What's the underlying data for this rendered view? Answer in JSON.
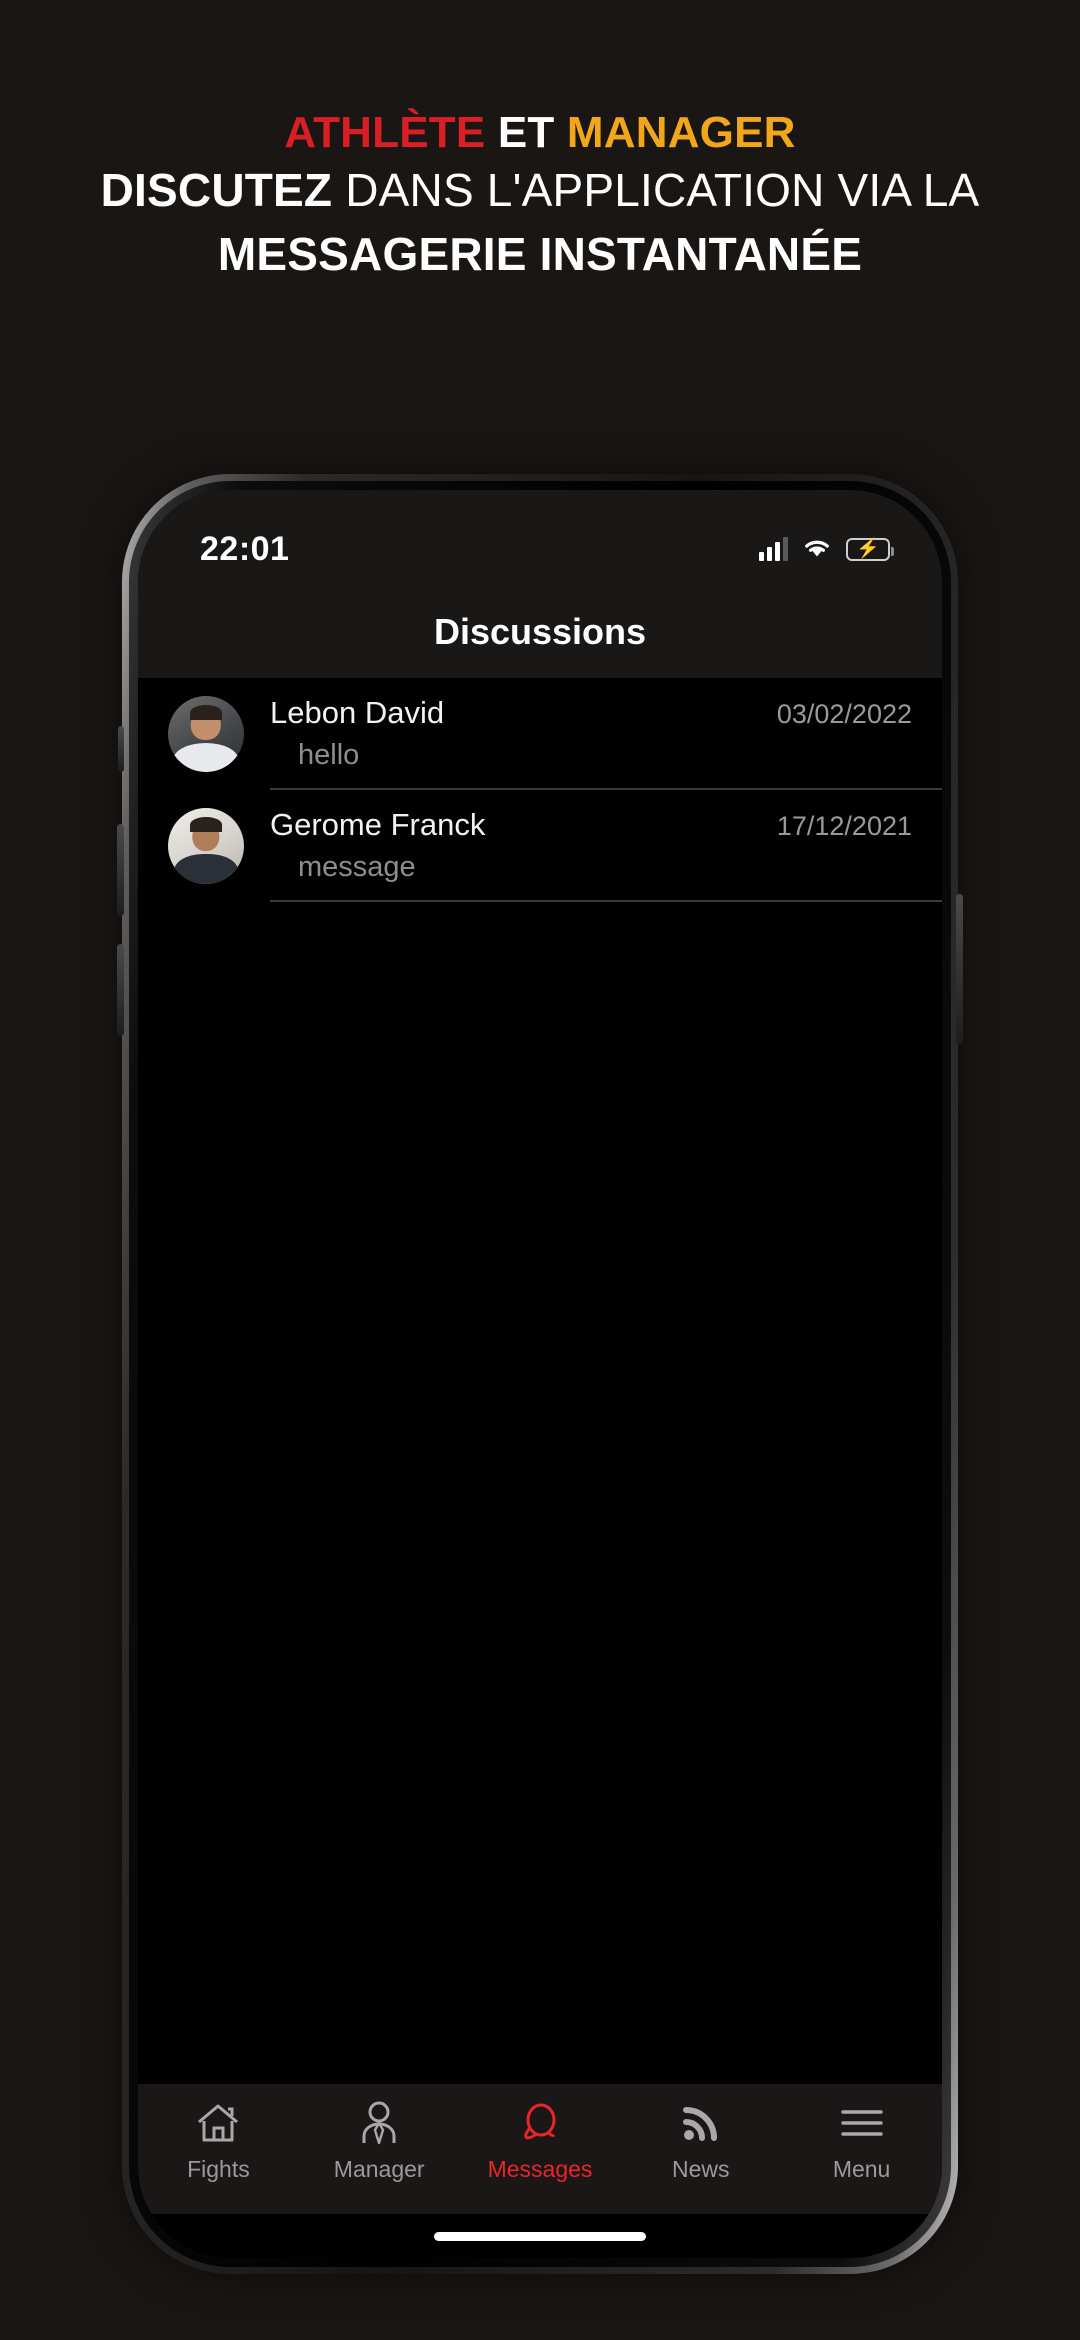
{
  "promo": {
    "line1": {
      "part1": "ATHLÈTE",
      "part2": "ET",
      "part3": "MANAGER"
    },
    "line2": {
      "bold": "DISCUTEZ",
      "rest": "DANS L'APPLICATION VIA LA"
    },
    "line3": "MESSAGERIE INSTANTANÉE",
    "colors": {
      "red": "#d91f26",
      "amber": "#f2a71b",
      "white": "#ffffff",
      "background": "#1a1614"
    }
  },
  "status_bar": {
    "time": "22:01",
    "cellular": "signal-bars-icon",
    "wifi": "wifi-icon",
    "battery": "battery-charging-icon",
    "battery_color": "#2ed158"
  },
  "nav": {
    "title": "Discussions"
  },
  "conversations": [
    {
      "name": "Lebon David",
      "preview": "hello",
      "date": "03/02/2022",
      "avatar": "photo-bearded-man"
    },
    {
      "name": "Gerome Franck",
      "preview": "message",
      "date": "17/12/2021",
      "avatar": "photo-man-in-suit"
    }
  ],
  "tabs": [
    {
      "label": "Fights",
      "icon": "home-icon",
      "active": false
    },
    {
      "label": "Manager",
      "icon": "person-icon",
      "active": false
    },
    {
      "label": "Messages",
      "icon": "chat-bubble-icon",
      "active": true
    },
    {
      "label": "News",
      "icon": "rss-icon",
      "active": false
    },
    {
      "label": "Menu",
      "icon": "hamburger-icon",
      "active": false
    }
  ],
  "active_tab_color": "#e8252b",
  "home_indicator": "home-indicator-bar"
}
